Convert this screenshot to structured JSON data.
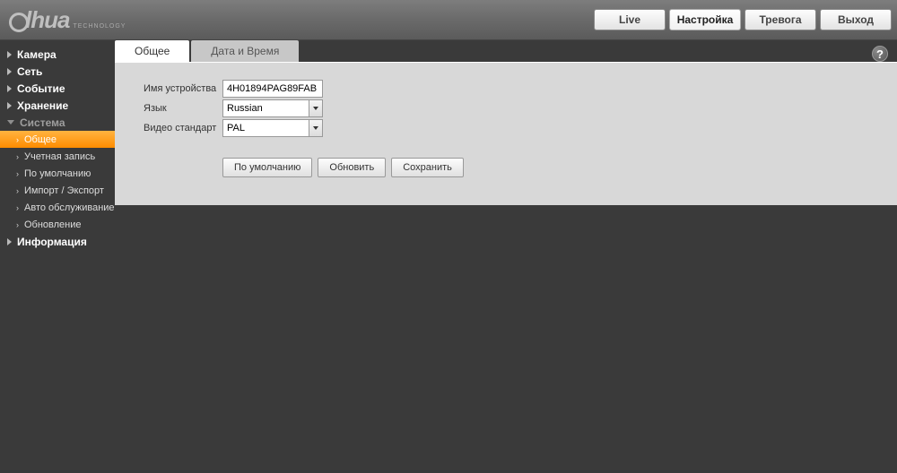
{
  "logo": {
    "text": "lhua",
    "sub": "TECHNOLOGY"
  },
  "nav": {
    "live": "Live",
    "settings": "Настройка",
    "alarm": "Тревога",
    "logout": "Выход"
  },
  "sidebar": {
    "camera": "Камера",
    "network": "Сеть",
    "event": "Событие",
    "storage": "Хранение",
    "system": "Система",
    "system_children": {
      "general": "Общее",
      "account": "Учетная запись",
      "default": "По умолчанию",
      "import_export": "Импорт / Экспорт",
      "auto_maintain": "Авто обслуживание",
      "upgrade": "Обновление"
    },
    "information": "Информация"
  },
  "tabs": {
    "general": "Общее",
    "datetime": "Дата и Время"
  },
  "form": {
    "device_name_label": "Имя устройства",
    "device_name_value": "4H01894PAG89FAB",
    "language_label": "Язык",
    "language_value": "Russian",
    "video_standard_label": "Видео стандарт",
    "video_standard_value": "PAL"
  },
  "buttons": {
    "default": "По умолчанию",
    "refresh": "Обновить",
    "save": "Сохранить"
  }
}
